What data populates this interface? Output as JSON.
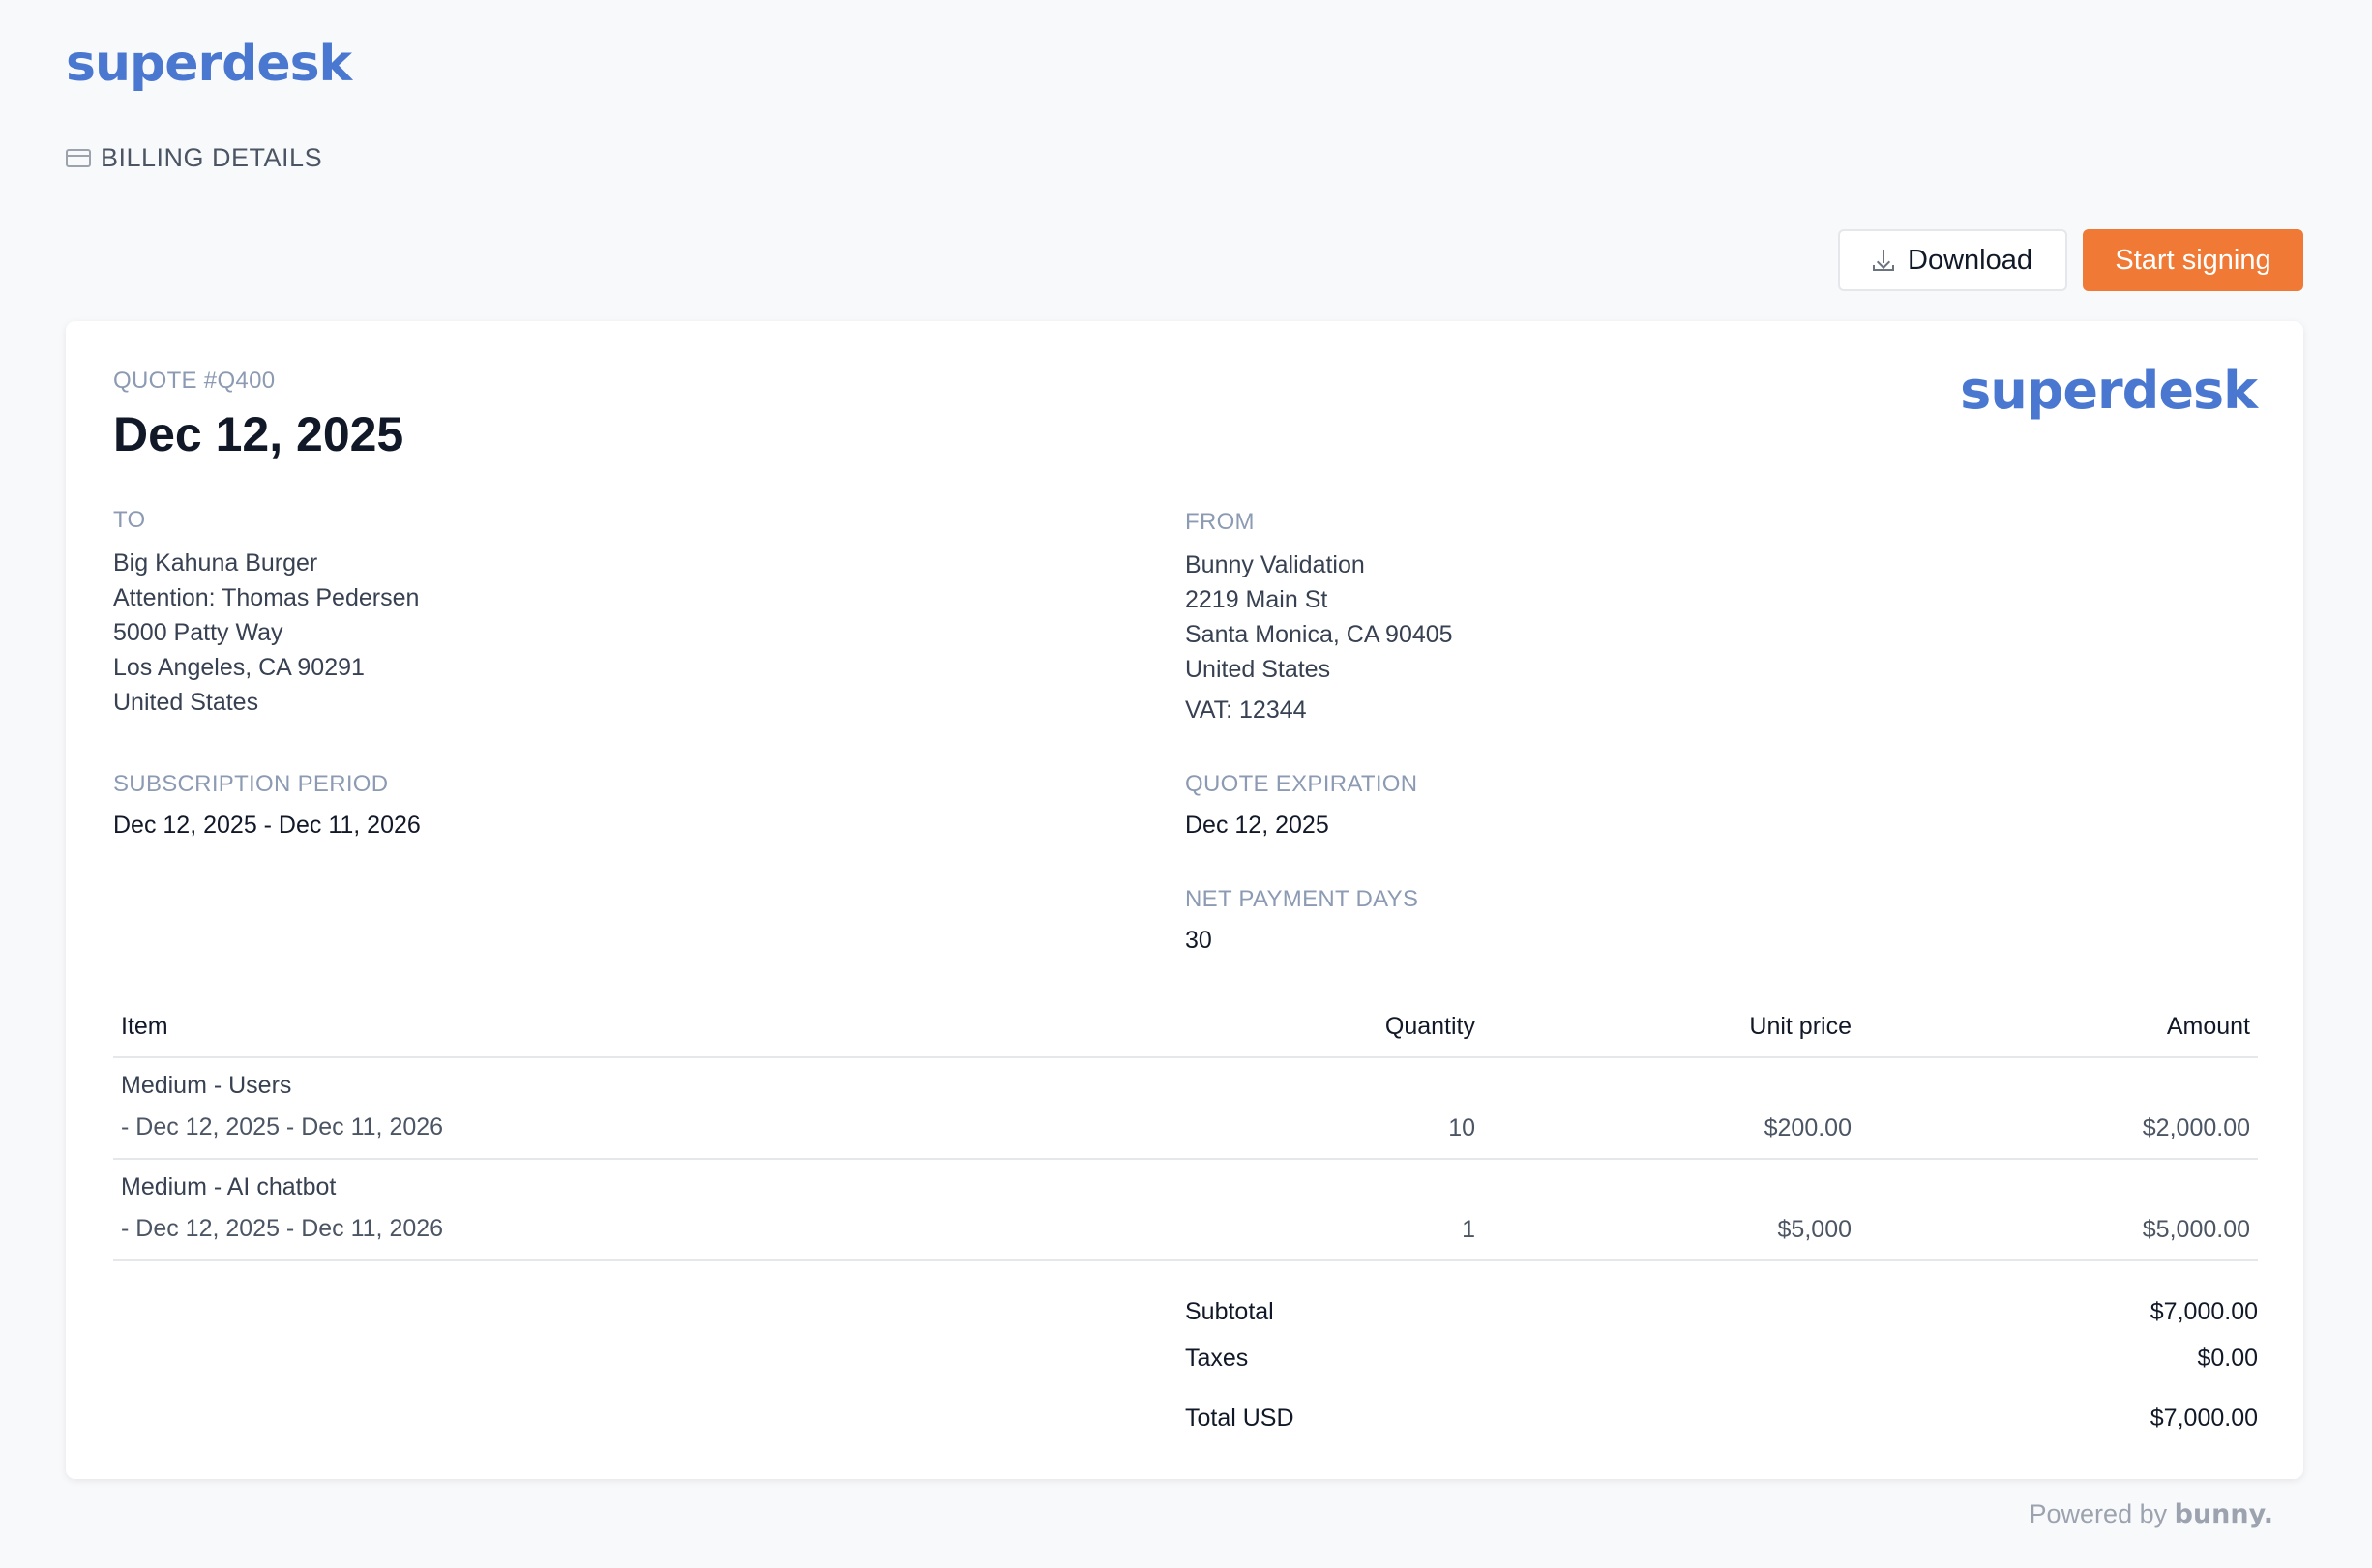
{
  "header": {
    "brand": "superdesk",
    "section_label": "BILLING DETAILS",
    "section_icon": "credit-card-icon"
  },
  "actions": {
    "download_label": "Download",
    "download_icon": "download-icon",
    "sign_label": "Start signing"
  },
  "quote": {
    "number_label": "QUOTE #Q400",
    "date": "Dec 12, 2025",
    "logo": "superdesk",
    "to": {
      "label": "TO",
      "lines": [
        "Big Kahuna Burger",
        "Attention: Thomas Pedersen",
        "5000 Patty Way",
        "Los Angeles, CA 90291",
        "United States"
      ]
    },
    "from": {
      "label": "FROM",
      "lines": [
        "Bunny Validation",
        "2219 Main St",
        "Santa Monica, CA 90405",
        "United States"
      ],
      "vat": "VAT: 12344"
    },
    "subscription_period": {
      "label": "SUBSCRIPTION PERIOD",
      "value": "Dec 12, 2025 - Dec 11, 2026"
    },
    "quote_expiration": {
      "label": "QUOTE EXPIRATION",
      "value": "Dec 12, 2025"
    },
    "net_payment_days": {
      "label": "NET PAYMENT DAYS",
      "value": "30"
    },
    "table": {
      "headers": {
        "item": "Item",
        "quantity": "Quantity",
        "unit_price": "Unit price",
        "amount": "Amount"
      },
      "rows": [
        {
          "name": "Medium - Users",
          "period": "- Dec 12, 2025 - Dec 11, 2026",
          "quantity": "10",
          "unit_price": "$200.00",
          "amount": "$2,000.00"
        },
        {
          "name": "Medium - AI chatbot",
          "period": "- Dec 12, 2025 - Dec 11, 2026",
          "quantity": "1",
          "unit_price": "$5,000",
          "amount": "$5,000.00"
        }
      ]
    },
    "totals": {
      "subtotal_label": "Subtotal",
      "subtotal": "$7,000.00",
      "taxes_label": "Taxes",
      "taxes": "$0.00",
      "total_label": "Total USD",
      "total": "$7,000.00"
    }
  },
  "footer": {
    "powered_by": "Powered by",
    "provider": "bunny."
  },
  "colors": {
    "brand": "#4a78d0",
    "accent": "#f07a35",
    "muted_label": "#8c9bb3"
  }
}
